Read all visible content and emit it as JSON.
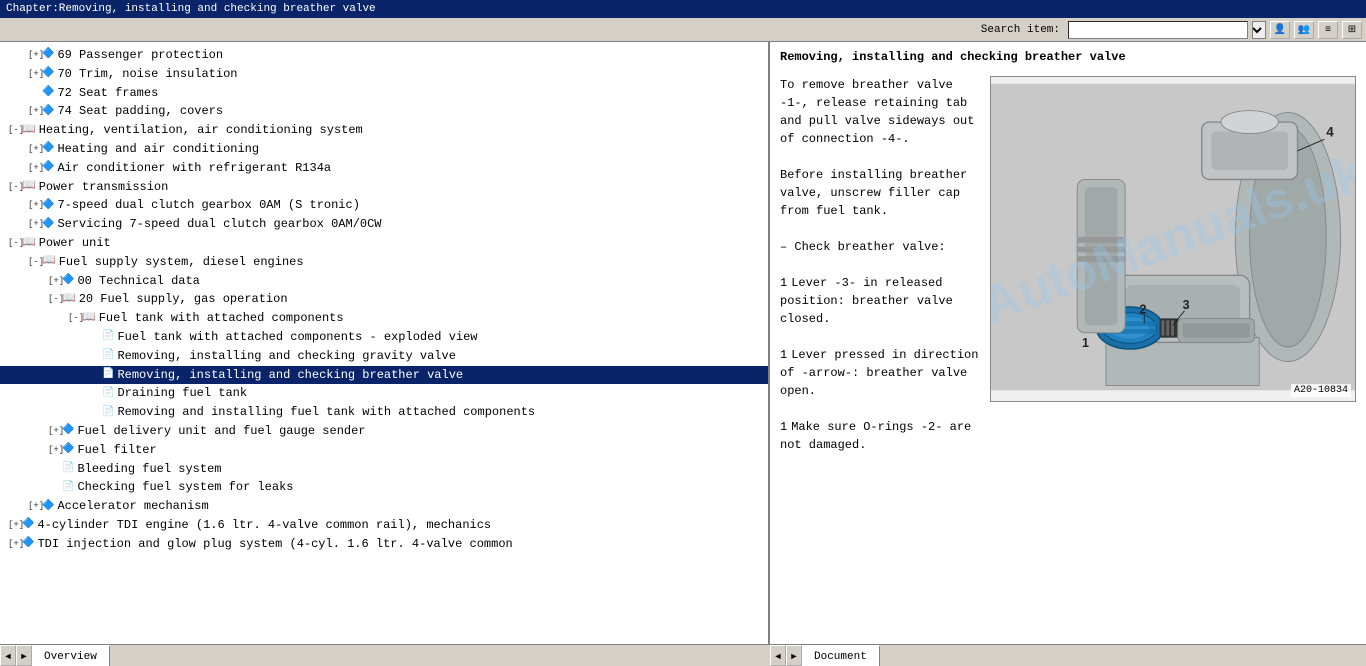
{
  "titleBar": {
    "text": "Chapter:Removing, installing and checking breather valve"
  },
  "toolbar": {
    "searchLabel": "Search item:",
    "searchPlaceholder": "",
    "searchValue": ""
  },
  "tree": {
    "items": [
      {
        "id": 1,
        "level": 1,
        "expander": "+",
        "icon": "diamond",
        "text": "69 Passenger protection",
        "selected": false
      },
      {
        "id": 2,
        "level": 1,
        "expander": "+",
        "icon": "diamond",
        "text": "70 Trim, noise insulation",
        "selected": false
      },
      {
        "id": 3,
        "level": 1,
        "expander": " ",
        "icon": "diamond",
        "text": "72 Seat frames",
        "selected": false
      },
      {
        "id": 4,
        "level": 1,
        "expander": "+",
        "icon": "diamond",
        "text": "74 Seat padding, covers",
        "selected": false
      },
      {
        "id": 5,
        "level": 0,
        "expander": "-",
        "icon": "book",
        "text": "Heating, ventilation, air conditioning system",
        "selected": false
      },
      {
        "id": 6,
        "level": 1,
        "expander": "+",
        "icon": "diamond",
        "text": "Heating and air conditioning",
        "selected": false
      },
      {
        "id": 7,
        "level": 1,
        "expander": "+",
        "icon": "diamond",
        "text": "Air conditioner with refrigerant R134a",
        "selected": false
      },
      {
        "id": 8,
        "level": 0,
        "expander": "-",
        "icon": "book",
        "text": "Power transmission",
        "selected": false
      },
      {
        "id": 9,
        "level": 1,
        "expander": "+",
        "icon": "diamond",
        "text": "7-speed dual clutch gearbox 0AM (S tronic)",
        "selected": false
      },
      {
        "id": 10,
        "level": 1,
        "expander": "+",
        "icon": "diamond",
        "text": "Servicing 7-speed dual clutch gearbox 0AM/0CW",
        "selected": false
      },
      {
        "id": 11,
        "level": 0,
        "expander": "-",
        "icon": "book",
        "text": "Power unit",
        "selected": false
      },
      {
        "id": 12,
        "level": 1,
        "expander": "-",
        "icon": "book",
        "text": "Fuel supply system, diesel engines",
        "selected": false
      },
      {
        "id": 13,
        "level": 2,
        "expander": "+",
        "icon": "diamond",
        "text": "00 Technical data",
        "selected": false
      },
      {
        "id": 14,
        "level": 2,
        "expander": "-",
        "icon": "book",
        "text": "20 Fuel supply, gas operation",
        "selected": false
      },
      {
        "id": 15,
        "level": 3,
        "expander": "-",
        "icon": "book",
        "text": "Fuel tank with attached components",
        "selected": false
      },
      {
        "id": 16,
        "level": 4,
        "expander": " ",
        "icon": "doc",
        "text": "Fuel tank with attached components - exploded view",
        "selected": false
      },
      {
        "id": 17,
        "level": 4,
        "expander": " ",
        "icon": "doc",
        "text": "Removing, installing and checking gravity valve",
        "selected": false
      },
      {
        "id": 18,
        "level": 4,
        "expander": " ",
        "icon": "doc",
        "text": "Removing, installing and checking breather valve",
        "selected": true
      },
      {
        "id": 19,
        "level": 4,
        "expander": " ",
        "icon": "doc",
        "text": "Draining fuel tank",
        "selected": false
      },
      {
        "id": 20,
        "level": 4,
        "expander": " ",
        "icon": "doc",
        "text": "Removing and installing fuel tank with attached components",
        "selected": false
      },
      {
        "id": 21,
        "level": 2,
        "expander": "+",
        "icon": "diamond",
        "text": "Fuel delivery unit and fuel gauge sender",
        "selected": false
      },
      {
        "id": 22,
        "level": 2,
        "expander": "+",
        "icon": "diamond",
        "text": "Fuel filter",
        "selected": false
      },
      {
        "id": 23,
        "level": 2,
        "expander": " ",
        "icon": "doc",
        "text": "Bleeding fuel system",
        "selected": false
      },
      {
        "id": 24,
        "level": 2,
        "expander": " ",
        "icon": "doc",
        "text": "Checking fuel system for leaks",
        "selected": false
      },
      {
        "id": 25,
        "level": 1,
        "expander": "+",
        "icon": "diamond",
        "text": "Accelerator mechanism",
        "selected": false
      },
      {
        "id": 26,
        "level": 0,
        "expander": "+",
        "icon": "diamond",
        "text": "4-cylinder TDI engine (1.6 ltr. 4-valve common rail), mechanics",
        "selected": false
      },
      {
        "id": 27,
        "level": 0,
        "expander": "+",
        "icon": "diamond",
        "text": "TDI injection and glow plug system (4-cyl. 1.6 ltr. 4-valve common",
        "selected": false
      }
    ]
  },
  "document": {
    "title": "Removing, installing and checking breather valve",
    "sections": [
      {
        "heading": "",
        "text": "To remove breather valve -1-, release retaining tab and pull valve sideways out of connection -4-."
      },
      {
        "heading": "",
        "text": "Before installing breather valve, unscrew filler cap from fuel tank."
      },
      {
        "heading": "– Check breather valve:",
        "text": ""
      },
      {
        "heading": "",
        "text": "Lever -3- in released position: breather valve closed.",
        "bullet": "1"
      },
      {
        "heading": "",
        "text": "Lever pressed in direction of -arrow-: breather valve open.",
        "bullet": "1"
      },
      {
        "heading": "",
        "text": "Make sure O-rings -2- are not damaged.",
        "bullet": "1"
      }
    ],
    "imageRef": "A20-10834",
    "callouts": [
      "1",
      "2",
      "3",
      "4"
    ]
  },
  "statusBar": {
    "leftTab": "Overview",
    "rightTab": "Document"
  },
  "icons": {
    "prev": "◄",
    "next": "►",
    "search1": "👤",
    "search2": "👥",
    "menu1": "≡",
    "menu2": "⊞"
  }
}
